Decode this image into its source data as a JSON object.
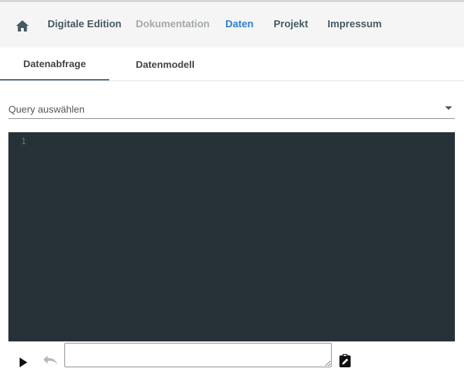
{
  "nav": {
    "home_icon": "home-icon",
    "items": [
      {
        "label": "Digitale Edition",
        "state": "normal"
      },
      {
        "label": "Dokumentation",
        "state": "muted"
      },
      {
        "label": "Daten",
        "state": "active"
      },
      {
        "label": "Projekt",
        "state": "normal"
      },
      {
        "label": "Impressum",
        "state": "normal"
      }
    ]
  },
  "tabs": [
    {
      "label": "Datenabfrage",
      "active": true
    },
    {
      "label": "Datenmodell",
      "active": false
    }
  ],
  "query_select": {
    "label": "Query auswählen",
    "icon": "chevron-down-icon"
  },
  "editor": {
    "line_numbers": [
      "1"
    ],
    "content": "",
    "background": "#263238"
  },
  "toolbar": {
    "run_icon": "play-icon",
    "undo_icon": "undo-icon",
    "textarea_value": "",
    "clipboard_icon": "clipboard-edit-icon"
  },
  "colors": {
    "accent": "#2f7fd4",
    "nav_text": "#455a64",
    "muted": "#a4a8ab"
  }
}
